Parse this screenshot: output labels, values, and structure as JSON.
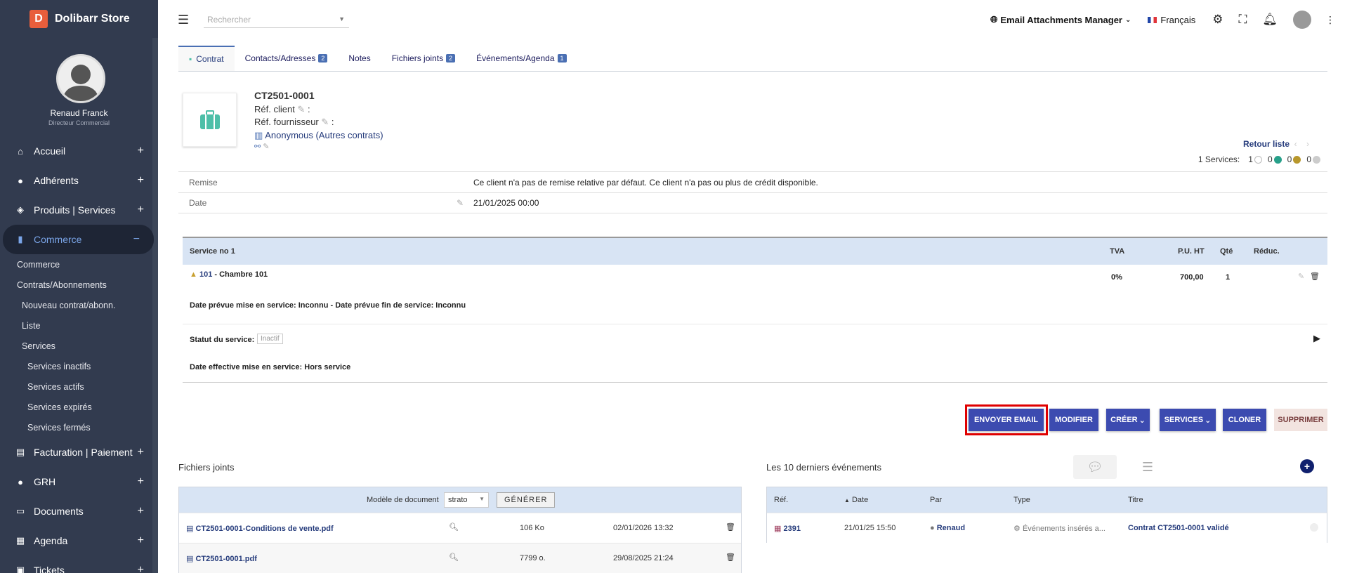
{
  "app": {
    "logo_letter": "D",
    "name": "Dolibarr Store"
  },
  "user": {
    "name": "Renaud Franck",
    "role": "Directeur Commercial"
  },
  "sidebar": {
    "items": [
      {
        "label": "Accueil",
        "icon": "home-icon"
      },
      {
        "label": "Adhérents",
        "icon": "user-icon"
      },
      {
        "label": "Produits | Services",
        "icon": "cube-icon"
      },
      {
        "label": "Commerce",
        "icon": "chart-icon"
      },
      {
        "label": "Facturation | Paiement",
        "icon": "money-icon"
      },
      {
        "label": "GRH",
        "icon": "user-tie-icon"
      },
      {
        "label": "Documents",
        "icon": "folder-icon"
      },
      {
        "label": "Agenda",
        "icon": "calendar-icon"
      },
      {
        "label": "Tickets",
        "icon": "ticket-icon"
      }
    ],
    "sub": {
      "commerce": "Commerce",
      "contrats": "Contrats/Abonnements",
      "nouveau": "Nouveau contrat/abonn.",
      "liste": "Liste",
      "services": "Services",
      "inactifs": "Services inactifs",
      "actifs": "Services actifs",
      "expires": "Services expirés",
      "fermes": "Services fermés"
    }
  },
  "topbar": {
    "search_placeholder": "Rechercher",
    "module": "Email Attachments Manager",
    "language": "Français"
  },
  "tabs": [
    {
      "label": "Contrat"
    },
    {
      "label": "Contacts/Adresses",
      "badge": "2"
    },
    {
      "label": "Notes"
    },
    {
      "label": "Fichiers joints",
      "badge": "2"
    },
    {
      "label": "Événements/Agenda",
      "badge": "1"
    }
  ],
  "contract": {
    "ref": "CT2501-0001",
    "ref_client": "Réf. client",
    "ref_fournisseur": "Réf. fournisseur",
    "thirdparty": "Anonymous (Autres contrats)",
    "retour": "Retour liste",
    "services_summary": "1 Services:",
    "counts": [
      "1",
      "0",
      "0",
      "0"
    ],
    "remise_label": "Remise",
    "remise_value": "Ce client n'a pas de remise relative par défaut. Ce client n'a pas ou plus de crédit disponible.",
    "date_label": "Date",
    "date_value": "21/01/2025 00:00"
  },
  "service": {
    "header": "Service no 1",
    "col_tva": "TVA",
    "col_pu": "P.U. HT",
    "col_qty": "Qté",
    "col_reduc": "Réduc.",
    "product_ref": "101",
    "product_label": " - Chambre 101",
    "tva": "0%",
    "pu": "700,00",
    "qty": "1",
    "dates": "Date prévue mise en service: Inconnu  -  Date prévue fin de service: Inconnu",
    "status_label": "Statut du service:",
    "status_value": "Inactif",
    "effective": "Date effective mise en service: Hors service"
  },
  "actions": {
    "send_email": "ENVOYER EMAIL",
    "modify": "MODIFIER",
    "create": "CRÉER",
    "services": "SERVICES",
    "clone": "CLONER",
    "delete": "SUPPRIMER"
  },
  "files": {
    "title": "Fichiers joints",
    "model_label": "Modèle de document",
    "model_value": "strato",
    "generate": "GÉNÉRER",
    "rows": [
      {
        "name": "CT2501-0001-Conditions de vente.pdf",
        "size": "106 Ko",
        "date": "02/01/2026 13:32"
      },
      {
        "name": "CT2501-0001.pdf",
        "size": "7799 o.",
        "date": "29/08/2025 21:24"
      }
    ]
  },
  "events": {
    "title": "Les 10 derniers événements",
    "cols": {
      "ref": "Réf.",
      "date": "Date",
      "par": "Par",
      "type": "Type",
      "titre": "Titre"
    },
    "rows": [
      {
        "ref": "2391",
        "date": "21/01/25 15:50",
        "par": "Renaud",
        "type": "Événements insérés a...",
        "titre": "Contrat CT2501-0001 validé"
      }
    ]
  },
  "colors": {
    "sidebar": "#323b4f",
    "accent": "#3c4bb0",
    "highlight": "#e00000"
  }
}
